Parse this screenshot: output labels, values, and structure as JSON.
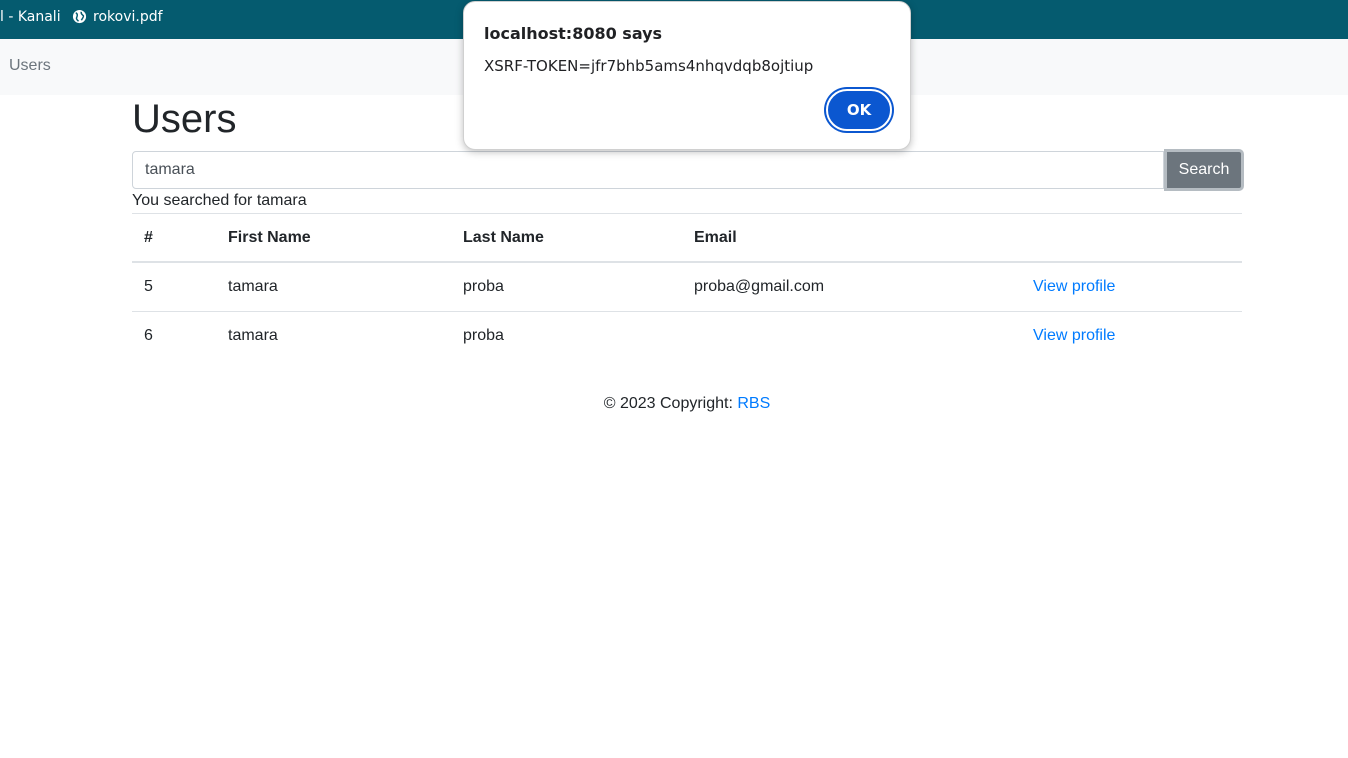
{
  "bookmarks": [
    {
      "label": "l - Kanali"
    },
    {
      "label": "rokovi.pdf",
      "icon": "globe-icon"
    }
  ],
  "navbar": {
    "link": "Users"
  },
  "page": {
    "title": "Users",
    "search": {
      "value": "tamara",
      "button": "Search"
    },
    "searched_text": "You searched for tamara"
  },
  "table": {
    "headers": [
      "#",
      "First Name",
      "Last Name",
      "Email",
      ""
    ],
    "rows": [
      {
        "id": "5",
        "first": "tamara",
        "last": "proba",
        "email": "proba@gmail.com",
        "action": "View profile"
      },
      {
        "id": "6",
        "first": "tamara",
        "last": "proba",
        "email": "",
        "action": "View profile"
      }
    ]
  },
  "footer": {
    "text": "© 2023 Copyright: ",
    "link": "RBS"
  },
  "dialog": {
    "title": "localhost:8080 says",
    "message": "XSRF-TOKEN=jfr7bhb5ams4nhqvdqb8ojtiup",
    "ok": "OK"
  },
  "colors": {
    "bookmarks_bar": "#055b6f",
    "link": "#007bff",
    "ok_button": "#0b57d0",
    "search_button": "#6c757d"
  }
}
